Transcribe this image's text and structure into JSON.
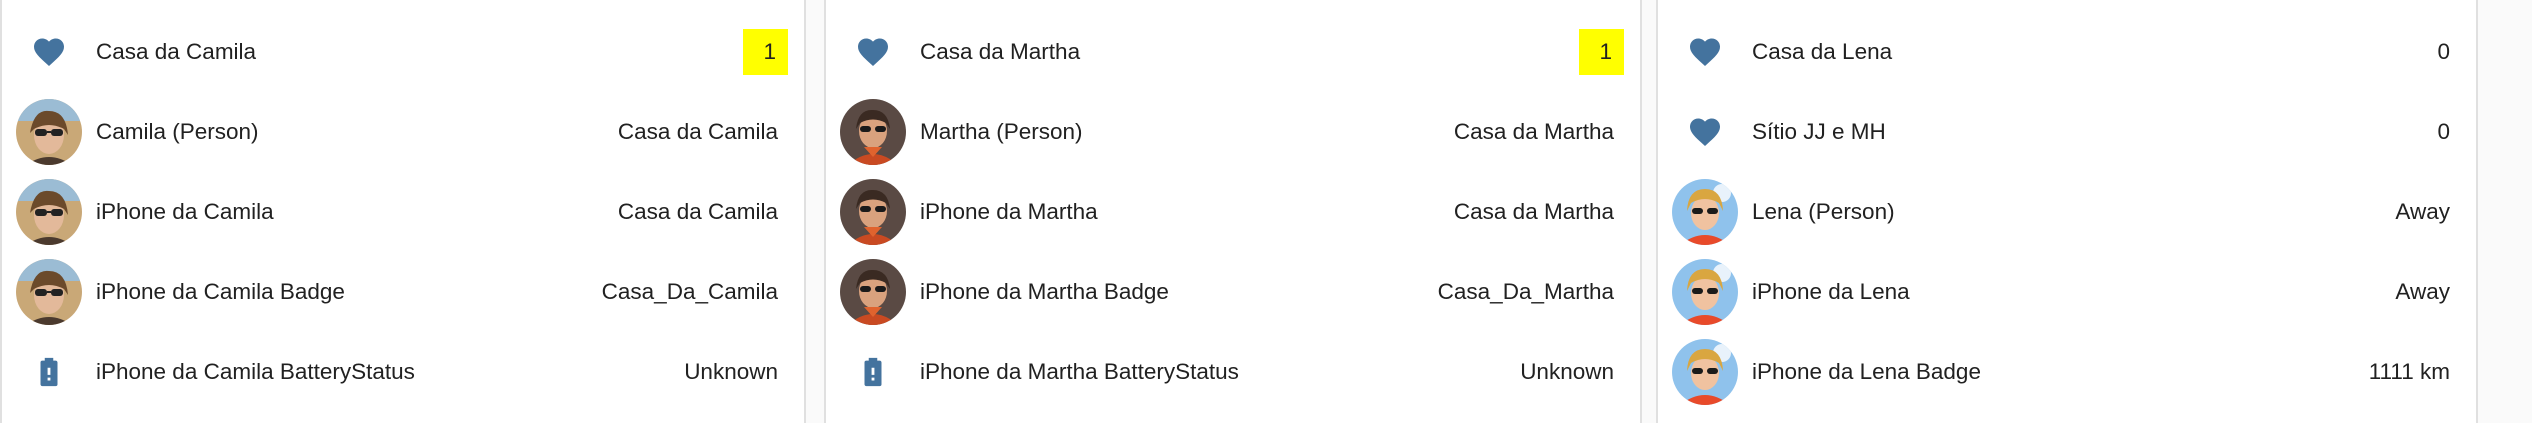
{
  "colors": {
    "icon": "#44739e",
    "highlight": "#ffff00",
    "text": "#212121"
  },
  "cards": [
    {
      "rows": [
        {
          "icon": "heart-icon",
          "name": "Casa da Camila",
          "state": "1",
          "highlight": true
        },
        {
          "icon": "avatar-camila",
          "name": "Camila (Person)",
          "state": "Casa da Camila"
        },
        {
          "icon": "avatar-camila",
          "name": "iPhone da Camila",
          "state": "Casa da Camila"
        },
        {
          "icon": "avatar-camila",
          "name": "iPhone da Camila Badge",
          "state": "Casa_Da_Camila"
        },
        {
          "icon": "battery-alert-icon",
          "name": "iPhone da Camila BatteryStatus",
          "state": "Unknown"
        }
      ]
    },
    {
      "rows": [
        {
          "icon": "heart-icon",
          "name": "Casa da Martha",
          "state": "1",
          "highlight": true
        },
        {
          "icon": "avatar-martha",
          "name": "Martha (Person)",
          "state": "Casa da Martha"
        },
        {
          "icon": "avatar-martha",
          "name": "iPhone da Martha",
          "state": "Casa da Martha"
        },
        {
          "icon": "avatar-martha",
          "name": "iPhone da Martha Badge",
          "state": "Casa_Da_Martha"
        },
        {
          "icon": "battery-alert-icon",
          "name": "iPhone da Martha BatteryStatus",
          "state": "Unknown"
        }
      ]
    },
    {
      "rows": [
        {
          "icon": "heart-icon",
          "name": "Casa da Lena",
          "state": "0"
        },
        {
          "icon": "heart-icon",
          "name": "Sítio JJ e MH",
          "state": "0"
        },
        {
          "icon": "avatar-lena",
          "name": "Lena (Person)",
          "state": "Away"
        },
        {
          "icon": "avatar-lena",
          "name": "iPhone da Lena",
          "state": "Away"
        },
        {
          "icon": "avatar-lena",
          "name": "iPhone da Lena Badge",
          "state": "1111 km"
        }
      ]
    }
  ]
}
